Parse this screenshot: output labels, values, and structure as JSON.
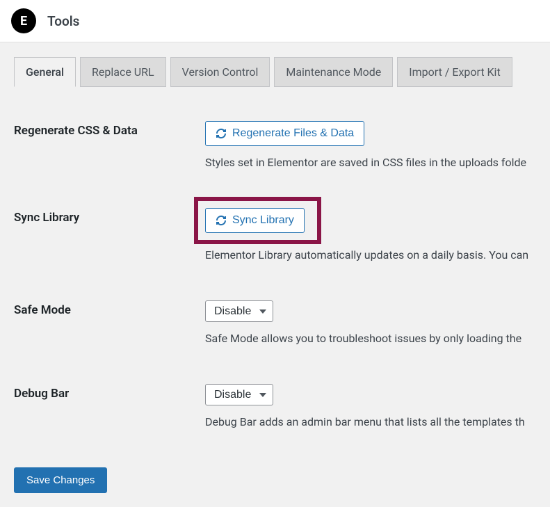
{
  "header": {
    "logo_letter": "E",
    "title": "Tools"
  },
  "tabs": [
    {
      "label": "General",
      "active": true
    },
    {
      "label": "Replace URL",
      "active": false
    },
    {
      "label": "Version Control",
      "active": false
    },
    {
      "label": "Maintenance Mode",
      "active": false
    },
    {
      "label": "Import / Export Kit",
      "active": false
    }
  ],
  "settings": {
    "regenerate": {
      "label": "Regenerate CSS & Data",
      "button": "Regenerate Files & Data",
      "description": "Styles set in Elementor are saved in CSS files in the uploads folde"
    },
    "sync": {
      "label": "Sync Library",
      "button": "Sync Library",
      "description": "Elementor Library automatically updates on a daily basis. You can"
    },
    "safe_mode": {
      "label": "Safe Mode",
      "value": "Disable",
      "description": "Safe Mode allows you to troubleshoot issues by only loading the"
    },
    "debug_bar": {
      "label": "Debug Bar",
      "value": "Disable",
      "description": "Debug Bar adds an admin bar menu that lists all the templates th"
    }
  },
  "save_button": "Save Changes"
}
